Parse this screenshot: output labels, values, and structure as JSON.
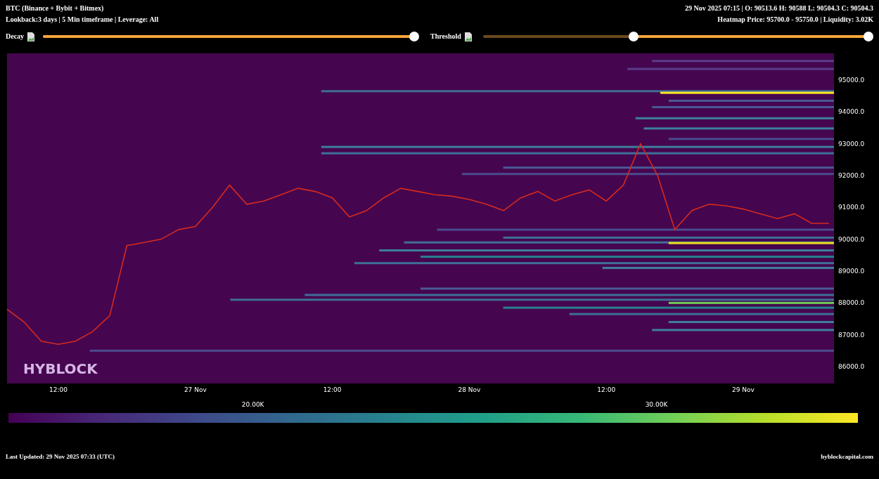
{
  "header": {
    "title": "BTC (Binance + Bybit + Bitmex)",
    "subtitle": "Lookback:3 days | 5 Min timeframe | Leverage: All",
    "ohlc": "29 Nov 2025 07:15 | O: 90513.6 H: 90588 L: 90504.3 C: 90504.3",
    "heatmap_info": "Heatmap Price: 95700.0 - 95750.0 | Liquidity: 3.02K"
  },
  "controls": {
    "decay": {
      "label": "Decay",
      "level": 1
    },
    "threshold": {
      "label": "Threshold",
      "thumbs": [
        {
          "level": 0.39
        },
        {
          "level": 1
        }
      ]
    }
  },
  "chart": {
    "logo": "HYBLOCK",
    "chart_data": {
      "type": "line",
      "ylim": [
        85470,
        95838
      ],
      "categories": [
        null,
        null,
        null,
        "12:00",
        null,
        null,
        null,
        null,
        null,
        null,
        null,
        "27 Nov",
        null,
        null,
        null,
        null,
        null,
        null,
        null,
        "12:00",
        null,
        null,
        null,
        null,
        null,
        null,
        null,
        "28 Nov",
        null,
        null,
        null,
        null,
        null,
        null,
        null,
        "12:00",
        null,
        null,
        null,
        null,
        null,
        null,
        null,
        "29 Nov",
        null,
        null,
        null,
        null,
        null
      ],
      "yticks": [
        {
          "value": 95000,
          "label": "95000.0"
        },
        {
          "value": 94000,
          "label": "94000.0"
        },
        {
          "value": 93000,
          "label": "93000.0"
        },
        {
          "value": 92000,
          "label": "92000.0"
        },
        {
          "value": 91000,
          "label": "91000.0"
        },
        {
          "value": 90000,
          "label": "90000.0"
        },
        {
          "value": 89000,
          "label": "89000.0"
        },
        {
          "value": 88000,
          "label": "88000.0"
        },
        {
          "value": 87000,
          "label": "87000.0"
        },
        {
          "value": 86000,
          "label": "86000.0"
        }
      ],
      "series": [
        {
          "color": "#d62a1e",
          "values": [
            87800,
            87400,
            86800,
            86700,
            86800,
            87100,
            87600,
            89800,
            89900,
            90000,
            90300,
            90400,
            91000,
            91700,
            91100,
            91200,
            91400,
            91600,
            91500,
            91300,
            90700,
            90900,
            91300,
            91600,
            91500,
            91400,
            91350,
            91250,
            91100,
            90900,
            91300,
            91500,
            91200,
            91400,
            91550,
            91200,
            91700,
            93000,
            92000,
            90300,
            90900,
            91100,
            91050,
            90950,
            90800,
            90650,
            90800,
            90500,
            90500
          ]
        }
      ]
    }
  },
  "colorbar": {
    "labels": [
      "20.00K",
      "30.00K"
    ]
  },
  "footer": {
    "updated": "Last Updated: 29 Nov 2025 07:33 (UTC)",
    "site": "hyblockcapital.com"
  }
}
